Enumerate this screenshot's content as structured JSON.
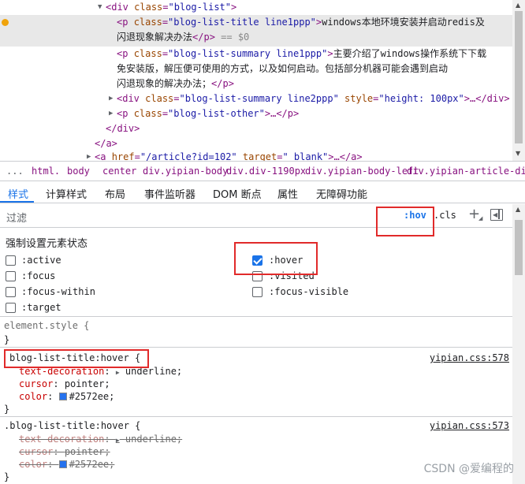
{
  "dom_tree": {
    "line1": {
      "open": "<",
      "tag": "div",
      "attr": "class",
      "eq": "=",
      "val": "\"blog-list\"",
      "close": ">"
    },
    "line2_selected": {
      "tag_open": "<p",
      "attr": "class",
      "eq": "=",
      "val": "\"blog-list-title line1ppp\"",
      "gt": ">",
      "text": "windows本地环境安装并启动redis及"
    },
    "line3_selected": {
      "text": "闪退现象解决办法",
      "close": "</p>",
      "ref": "== $0"
    },
    "line4": {
      "tag_open": "<p",
      "attr": "class",
      "eq": "=",
      "val": "\"blog-list-summary line1ppp\"",
      "gt": ">",
      "text": "主要介绍了windows操作系统下下载"
    },
    "line5": {
      "text": "免安装版，解压便可使用的方式，以及如何启动。包括部分机器可能会遇到启动"
    },
    "line6": {
      "text": "闪退现象的解决办法；",
      "close": "</p>"
    },
    "line7": {
      "tag_open": "<div",
      "attr": "class",
      "eq": "=",
      "val": "\"blog-list-summary line2ppp\"",
      "attr2": "style",
      "val2": "\"height: 100px\"",
      "gt": ">…</div>"
    },
    "line8": {
      "tag_open": "<p",
      "attr": "class",
      "eq": "=",
      "val": "\"blog-list-other\"",
      "gt": ">…</p>"
    },
    "line9": {
      "close": "</div>"
    },
    "line10": {
      "close": "</a>"
    },
    "line11": {
      "tag_open": "<a",
      "attr": "href",
      "eq": "=",
      "val": "\"/article?id=102\"",
      "attr2": "target",
      "val2": "\"_blank\"",
      "gt": ">…</a>"
    }
  },
  "breadcrumbs": {
    "ellipsis": "...",
    "items": [
      "html.",
      "body",
      "center",
      "div.yipian-body",
      "div.div-1190px",
      "div.yipian-body-left",
      "div.yipian-article-div"
    ]
  },
  "tabs": [
    "样式",
    "计算样式",
    "布局",
    "事件监听器",
    "DOM 断点",
    "属性",
    "无障碍功能"
  ],
  "filter": {
    "label": "过滤",
    "hov": ":hov",
    "cls": ".cls",
    "plus": "+"
  },
  "force_state": {
    "title": "强制设置元素状态",
    "states": [
      {
        "label": ":active",
        "checked": false
      },
      {
        "label": ":hover",
        "checked": true
      },
      {
        "label": ":focus",
        "checked": false
      },
      {
        "label": ":visited",
        "checked": false
      },
      {
        "label": ":focus-within",
        "checked": false
      },
      {
        "label": ":focus-visible",
        "checked": false
      },
      {
        "label": ":target",
        "checked": false
      }
    ]
  },
  "rules": {
    "element_style": {
      "selector": "element.style {",
      "close": "}"
    },
    "rule1": {
      "selector": "blog-list-title:hover {",
      "source": "yipian.css:578",
      "props": [
        {
          "name": "text-decoration",
          "value": "underline;"
        },
        {
          "name": "cursor",
          "value": "pointer;"
        },
        {
          "name": "color",
          "value": "#2572ee;"
        }
      ],
      "close": "}"
    },
    "rule2": {
      "selector": ".blog-list-title:hover {",
      "source": "yipian.css:573",
      "props": [
        {
          "name": "text-decoration",
          "value": "underline;"
        },
        {
          "name": "cursor",
          "value": "pointer;"
        },
        {
          "name": "color",
          "value": "#2572ee;"
        }
      ],
      "close": "}"
    }
  },
  "colors": {
    "accent": "#1a73e8",
    "swatch": "#2572ee",
    "highlight_box": "#e12a2a"
  },
  "watermark": "CSDN @爱编程的"
}
